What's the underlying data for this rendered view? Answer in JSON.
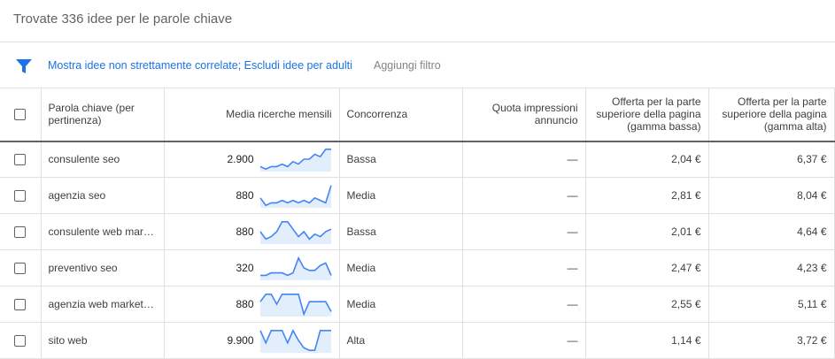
{
  "header": {
    "title": "Trovate 336 idee per le parole chiave"
  },
  "filter": {
    "links": "Mostra idee non strettamente correlate; Escludi idee per adulti",
    "add": "Aggiungi filtro",
    "color": "#1a73e8"
  },
  "table": {
    "columns": {
      "keyword": "Parola chiave (per pertinenza)",
      "volume": "Media ricerche mensili",
      "competition": "Concorrenza",
      "impression_share": "Quota impressioni annuncio",
      "bid_low": "Offerta per la parte superiore della pagina (gamma bassa)",
      "bid_high": "Offerta per la parte superiore della pagina (gamma alta)"
    },
    "rows": [
      {
        "keyword": "consulente seo",
        "volume": "2.900",
        "trend": [
          0.2,
          0.1,
          0.2,
          0.2,
          0.3,
          0.2,
          0.4,
          0.3,
          0.5,
          0.5,
          0.7,
          0.6,
          0.9,
          0.9
        ],
        "competition": "Bassa",
        "impression_share": "—",
        "bid_low": "2,04 €",
        "bid_high": "6,37 €"
      },
      {
        "keyword": "agenzia seo",
        "volume": "880",
        "trend": [
          0.4,
          0.1,
          0.2,
          0.2,
          0.3,
          0.2,
          0.3,
          0.2,
          0.3,
          0.2,
          0.4,
          0.3,
          0.2,
          0.9
        ],
        "competition": "Media",
        "impression_share": "—",
        "bid_low": "2,81 €",
        "bid_high": "8,04 €"
      },
      {
        "keyword": "consulente web marketing",
        "volume": "880",
        "trend": [
          0.5,
          0.2,
          0.3,
          0.5,
          0.9,
          0.9,
          0.6,
          0.3,
          0.5,
          0.2,
          0.4,
          0.3,
          0.5,
          0.6
        ],
        "competition": "Bassa",
        "impression_share": "—",
        "bid_low": "2,01 €",
        "bid_high": "4,64 €"
      },
      {
        "keyword": "preventivo seo",
        "volume": "320",
        "trend": [
          0.2,
          0.2,
          0.3,
          0.3,
          0.3,
          0.2,
          0.3,
          0.9,
          0.5,
          0.4,
          0.4,
          0.6,
          0.7,
          0.2
        ],
        "competition": "Media",
        "impression_share": "—",
        "bid_low": "2,47 €",
        "bid_high": "4,23 €"
      },
      {
        "keyword": "agenzia web marketing",
        "volume": "880",
        "trend": [
          0.6,
          0.9,
          0.9,
          0.5,
          0.9,
          0.9,
          0.9,
          0.9,
          0.1,
          0.6,
          0.6,
          0.6,
          0.6,
          0.2
        ],
        "competition": "Media",
        "impression_share": "—",
        "bid_low": "2,55 €",
        "bid_high": "5,11 €"
      },
      {
        "keyword": "sito web",
        "volume": "9.900",
        "trend": [
          0.9,
          0.4,
          0.9,
          0.9,
          0.9,
          0.4,
          0.9,
          0.5,
          0.2,
          0.1,
          0.1,
          0.9,
          0.9,
          0.9
        ],
        "competition": "Alta",
        "impression_share": "—",
        "bid_low": "1,14 €",
        "bid_high": "3,72 €"
      }
    ]
  },
  "colors": {
    "spark_line": "#4285f4",
    "spark_fill": "#e3eefc"
  }
}
